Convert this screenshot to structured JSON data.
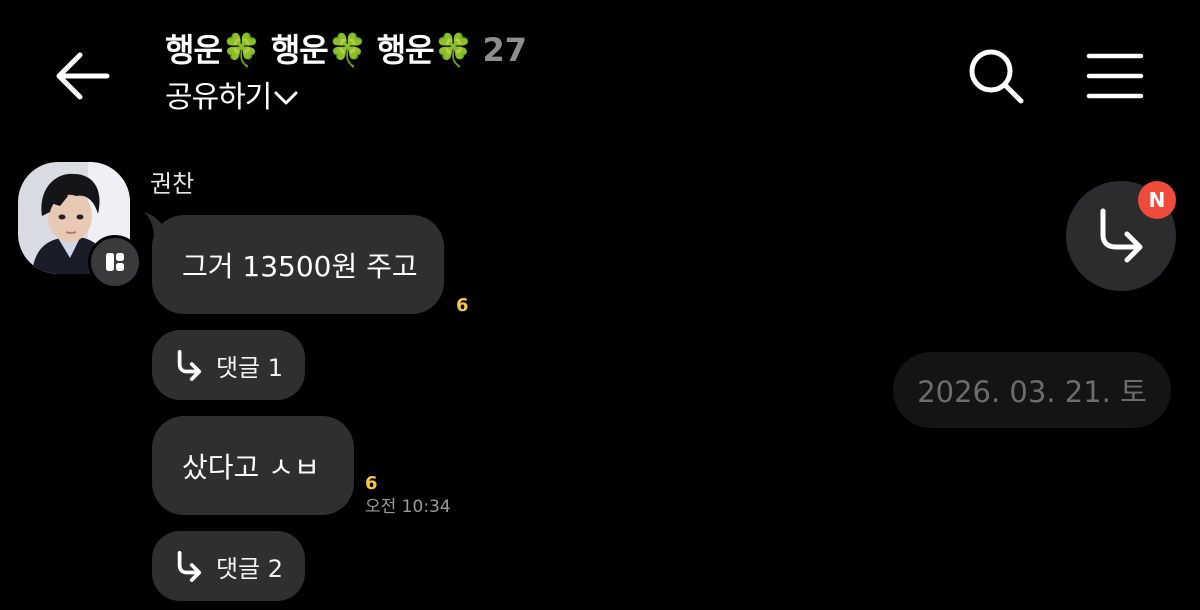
{
  "header": {
    "title": "행운🍀 행운🍀 행운🍀",
    "member_count": "27",
    "share_label": "공유하기",
    "back_icon": "arrow-left-icon",
    "search_icon": "search-icon",
    "menu_icon": "hamburger-menu-icon"
  },
  "chat": {
    "sender_name": "권찬",
    "messages": [
      {
        "text": "그거 13500원 주고",
        "unread": "6",
        "time": "",
        "reply_label": "댓글 1"
      },
      {
        "text": "샀다고 ㅅㅂ",
        "unread": "6",
        "time": "오전 10:34",
        "reply_label": "댓글 2"
      }
    ]
  },
  "date_separator": "2026. 03. 21. 토",
  "jump_button": {
    "icon": "reply-arrow-icon",
    "badge": "N"
  },
  "colors": {
    "background": "#000000",
    "bubble": "#2f2f2f",
    "unread": "#f5c64a",
    "new_badge": "#ee4b3a"
  }
}
